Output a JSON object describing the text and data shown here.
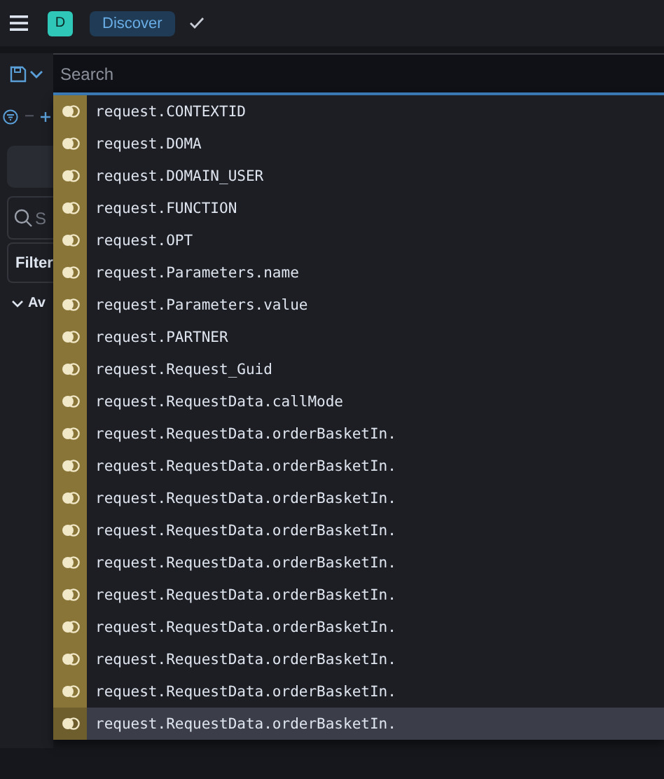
{
  "header": {
    "avatar": "D",
    "app": "Discover"
  },
  "query": {
    "placeholder": "Search"
  },
  "sidebar": {
    "search": {
      "placeholder": "S"
    },
    "filter": "Filter",
    "section": "Av"
  },
  "suggestions": [
    {
      "label": "request.CONTEXTID",
      "selected": false
    },
    {
      "label": "request.DOMA",
      "selected": false
    },
    {
      "label": "request.DOMAIN_USER",
      "selected": false
    },
    {
      "label": "request.FUNCTION",
      "selected": false
    },
    {
      "label": "request.OPT",
      "selected": false
    },
    {
      "label": "request.Parameters.name",
      "selected": false
    },
    {
      "label": "request.Parameters.value",
      "selected": false
    },
    {
      "label": "request.PARTNER",
      "selected": false
    },
    {
      "label": "request.Request_Guid",
      "selected": false
    },
    {
      "label": "request.RequestData.callMode",
      "selected": false
    },
    {
      "label": "request.RequestData.orderBasketIn.",
      "selected": false
    },
    {
      "label": "request.RequestData.orderBasketIn.",
      "selected": false
    },
    {
      "label": "request.RequestData.orderBasketIn.",
      "selected": false
    },
    {
      "label": "request.RequestData.orderBasketIn.",
      "selected": false
    },
    {
      "label": "request.RequestData.orderBasketIn.",
      "selected": false
    },
    {
      "label": "request.RequestData.orderBasketIn.",
      "selected": false
    },
    {
      "label": "request.RequestData.orderBasketIn.",
      "selected": false
    },
    {
      "label": "request.RequestData.orderBasketIn.",
      "selected": false
    },
    {
      "label": "request.RequestData.orderBasketIn.",
      "selected": false
    },
    {
      "label": "request.RequestData.orderBasketIn.",
      "selected": true
    }
  ]
}
